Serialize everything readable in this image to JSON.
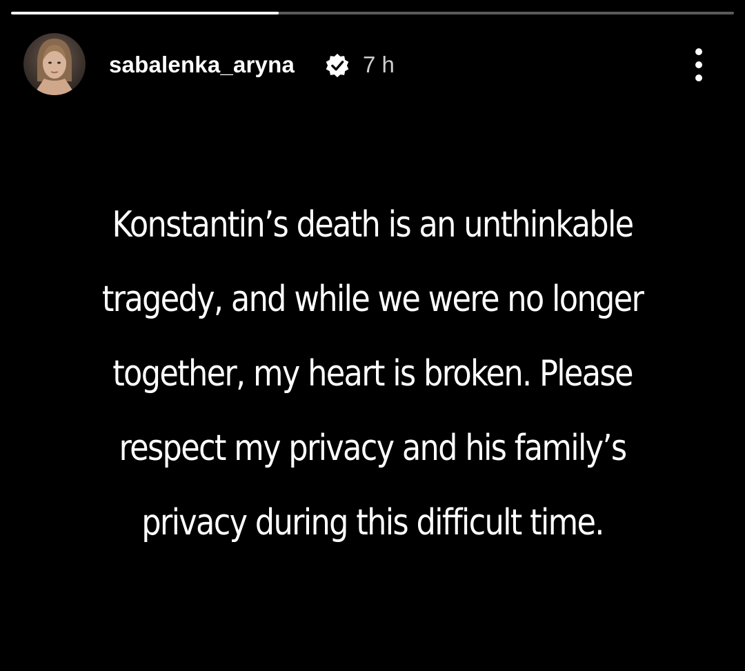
{
  "story": {
    "progress_fraction": 0.37,
    "username": "sabalenka_aryna",
    "verified_icon": "verified-badge-icon",
    "timestamp": "7 h",
    "more_icon": "more-vertical-icon",
    "text": "Konstantin’s death is an unthinkable tragedy, and while we were no longer together, my heart is broken. Please respect my privacy and his family’s privacy during this difficult time."
  },
  "colors": {
    "background": "#000000",
    "text": "#ffffff",
    "progress_track": "#5a5a5a",
    "progress_fill": "#ffffff"
  }
}
